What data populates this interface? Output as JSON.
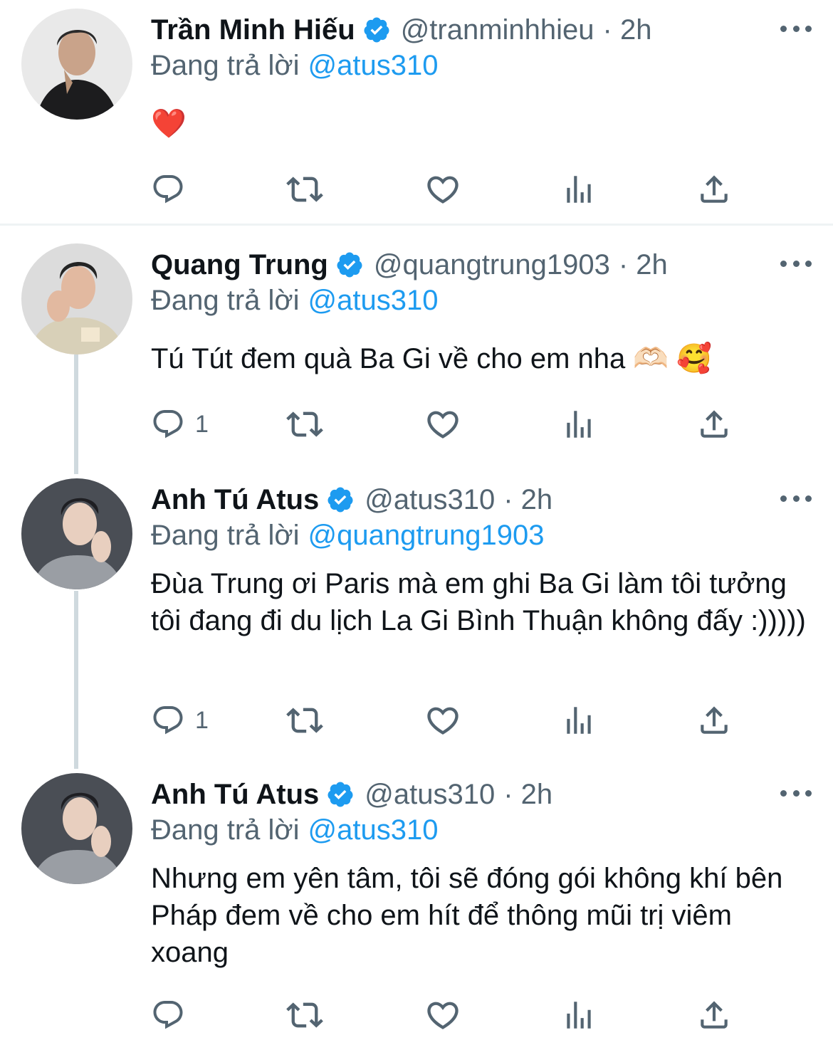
{
  "tweets": [
    {
      "name": "Trần Minh Hiếu",
      "handle": "@tranminhhieu",
      "time": "· 2h",
      "replying_prefix": "Đang trả lời",
      "replying_to": "@atus310",
      "text": "❤️",
      "reply_count": ""
    },
    {
      "name": "Quang Trung",
      "handle": "@quangtrung1903",
      "time": "· 2h",
      "replying_prefix": "Đang trả lời",
      "replying_to": "@atus310",
      "text": "Tú Tút đem quà Ba Gi về cho em nha 🫶🏻 🥰",
      "reply_count": "1"
    },
    {
      "name": "Anh Tú Atus",
      "handle": "@atus310",
      "time": "· 2h",
      "replying_prefix": "Đang trả lời",
      "replying_to": "@quangtrung1903",
      "text": "Đùa Trung ơi Paris mà em ghi Ba Gi làm tôi tưởng tôi đang đi du lịch La Gi Bình Thuận không đấy :)))))",
      "reply_count": "1"
    },
    {
      "name": "Anh Tú Atus",
      "handle": "@atus310",
      "time": "· 2h",
      "replying_prefix": "Đang trả lời",
      "replying_to": "@atus310",
      "text": "Nhưng em yên tâm, tôi sẽ đóng gói không khí bên Pháp đem về cho em hít để thông mũi trị viêm xoang",
      "reply_count": ""
    }
  ],
  "icons": {
    "reply": "reply-icon",
    "retweet": "retweet-icon",
    "like": "like-icon",
    "views": "views-icon",
    "share": "share-icon",
    "verified": "verified-badge-icon",
    "more": "more-icon"
  },
  "colors": {
    "link": "#1d9bf0",
    "secondary_text": "#536471",
    "thread_line": "#cfd9de",
    "verified": "#1d9bf0"
  }
}
